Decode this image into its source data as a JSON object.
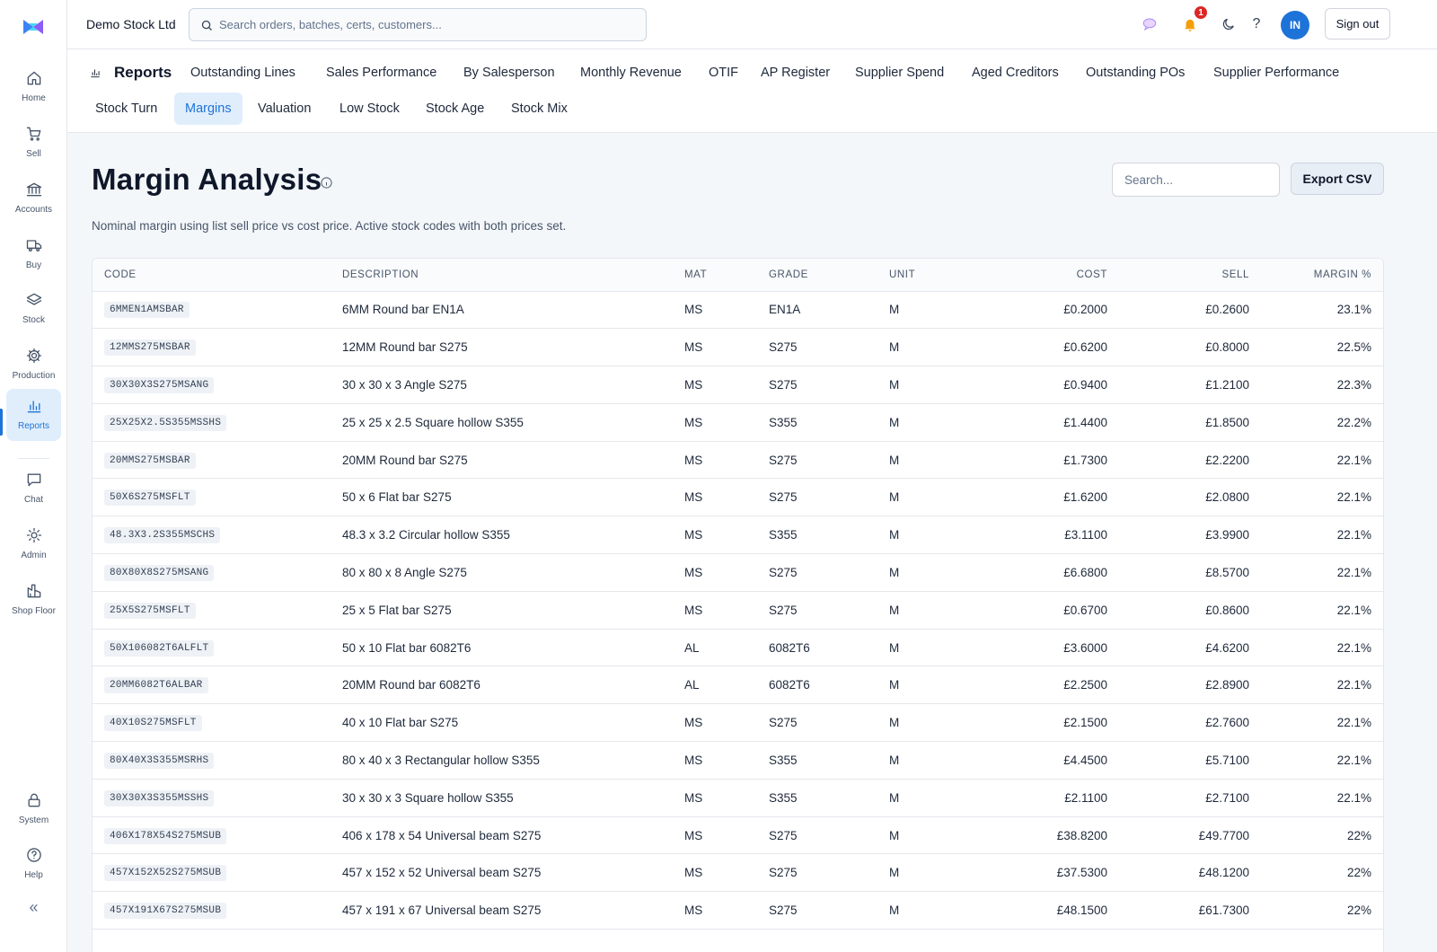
{
  "app": {
    "company": "Demo Stock Ltd",
    "search_placeholder": "Search orders, batches, certs, customers...",
    "notification_count": "1",
    "avatar_initials": "IN",
    "signout_label": "Sign out",
    "accent_color": "#1e73d8"
  },
  "sidebar": {
    "items": [
      {
        "label": "Home",
        "icon": "home-icon"
      },
      {
        "label": "Sell",
        "icon": "cart-icon"
      },
      {
        "label": "Accounts",
        "icon": "bank-icon"
      },
      {
        "label": "Buy",
        "icon": "truck-icon"
      },
      {
        "label": "Stock",
        "icon": "layers-icon"
      },
      {
        "label": "Production",
        "icon": "gear-icon"
      },
      {
        "label": "Reports",
        "icon": "bar-chart-icon",
        "active": true
      },
      {
        "label": "Chat",
        "icon": "chat-icon"
      },
      {
        "label": "Admin",
        "icon": "sun-icon"
      },
      {
        "label": "Shop Floor",
        "icon": "factory-icon"
      },
      {
        "label": "System",
        "icon": "lock-icon"
      },
      {
        "label": "Help",
        "icon": "help-circle-icon"
      }
    ],
    "collapse_label": "«"
  },
  "reports_nav": {
    "heading": "Reports",
    "tabs": [
      "Outstanding Lines",
      "Sales Performance",
      "By Salesperson",
      "Monthly Revenue",
      "OTIF",
      "AP Register",
      "Supplier Spend",
      "Aged Creditors",
      "Outstanding POs",
      "Supplier Performance",
      "Stock Turn",
      "Margins",
      "Valuation",
      "Low Stock",
      "Stock Age",
      "Stock Mix"
    ],
    "active_tab": "Margins"
  },
  "page": {
    "title": "Margin Analysis",
    "subtitle": "Nominal margin using list sell price vs cost price. Active stock codes with both prices set.",
    "search_placeholder": "Search...",
    "export_label": "Export CSV"
  },
  "table": {
    "columns": [
      "CODE",
      "DESCRIPTION",
      "MAT",
      "GRADE",
      "UNIT",
      "COST",
      "SELL",
      "MARGIN %"
    ],
    "rows": [
      {
        "code": "6MMEN1AMSBAR",
        "desc": "6MM Round bar EN1A",
        "mat": "MS",
        "grade": "EN1A",
        "unit": "M",
        "cost": "£0.2000",
        "sell": "£0.2600",
        "margin": "23.1%"
      },
      {
        "code": "12MMS275MSBAR",
        "desc": "12MM Round bar S275",
        "mat": "MS",
        "grade": "S275",
        "unit": "M",
        "cost": "£0.6200",
        "sell": "£0.8000",
        "margin": "22.5%"
      },
      {
        "code": "30X30X3S275MSANG",
        "desc": "30 x 30 x 3 Angle S275",
        "mat": "MS",
        "grade": "S275",
        "unit": "M",
        "cost": "£0.9400",
        "sell": "£1.2100",
        "margin": "22.3%"
      },
      {
        "code": "25X25X2.5S355MSSHS",
        "desc": "25 x 25 x 2.5 Square hollow S355",
        "mat": "MS",
        "grade": "S355",
        "unit": "M",
        "cost": "£1.4400",
        "sell": "£1.8500",
        "margin": "22.2%"
      },
      {
        "code": "20MMS275MSBAR",
        "desc": "20MM Round bar S275",
        "mat": "MS",
        "grade": "S275",
        "unit": "M",
        "cost": "£1.7300",
        "sell": "£2.2200",
        "margin": "22.1%"
      },
      {
        "code": "50X6S275MSFLT",
        "desc": "50 x 6 Flat bar S275",
        "mat": "MS",
        "grade": "S275",
        "unit": "M",
        "cost": "£1.6200",
        "sell": "£2.0800",
        "margin": "22.1%"
      },
      {
        "code": "48.3X3.2S355MSCHS",
        "desc": "48.3 x 3.2 Circular hollow S355",
        "mat": "MS",
        "grade": "S355",
        "unit": "M",
        "cost": "£3.1100",
        "sell": "£3.9900",
        "margin": "22.1%"
      },
      {
        "code": "80X80X8S275MSANG",
        "desc": "80 x 80 x 8 Angle S275",
        "mat": "MS",
        "grade": "S275",
        "unit": "M",
        "cost": "£6.6800",
        "sell": "£8.5700",
        "margin": "22.1%"
      },
      {
        "code": "25X5S275MSFLT",
        "desc": "25 x 5 Flat bar S275",
        "mat": "MS",
        "grade": "S275",
        "unit": "M",
        "cost": "£0.6700",
        "sell": "£0.8600",
        "margin": "22.1%"
      },
      {
        "code": "50X106082T6ALFLT",
        "desc": "50 x 10 Flat bar 6082T6",
        "mat": "AL",
        "grade": "6082T6",
        "unit": "M",
        "cost": "£3.6000",
        "sell": "£4.6200",
        "margin": "22.1%"
      },
      {
        "code": "20MM6082T6ALBAR",
        "desc": "20MM Round bar 6082T6",
        "mat": "AL",
        "grade": "6082T6",
        "unit": "M",
        "cost": "£2.2500",
        "sell": "£2.8900",
        "margin": "22.1%"
      },
      {
        "code": "40X10S275MSFLT",
        "desc": "40 x 10 Flat bar S275",
        "mat": "MS",
        "grade": "S275",
        "unit": "M",
        "cost": "£2.1500",
        "sell": "£2.7600",
        "margin": "22.1%"
      },
      {
        "code": "80X40X3S355MSRHS",
        "desc": "80 x 40 x 3 Rectangular hollow S355",
        "mat": "MS",
        "grade": "S355",
        "unit": "M",
        "cost": "£4.4500",
        "sell": "£5.7100",
        "margin": "22.1%"
      },
      {
        "code": "30X30X3S355MSSHS",
        "desc": "30 x 30 x 3 Square hollow S355",
        "mat": "MS",
        "grade": "S355",
        "unit": "M",
        "cost": "£2.1100",
        "sell": "£2.7100",
        "margin": "22.1%"
      },
      {
        "code": "406X178X54S275MSUB",
        "desc": "406 x 178 x 54 Universal beam S275",
        "mat": "MS",
        "grade": "S275",
        "unit": "M",
        "cost": "£38.8200",
        "sell": "£49.7700",
        "margin": "22%"
      },
      {
        "code": "457X152X52S275MSUB",
        "desc": "457 x 152 x 52 Universal beam S275",
        "mat": "MS",
        "grade": "S275",
        "unit": "M",
        "cost": "£37.5300",
        "sell": "£48.1200",
        "margin": "22%"
      },
      {
        "code": "457X191X67S275MSUB",
        "desc": "457 x 191 x 67 Universal beam S275",
        "mat": "MS",
        "grade": "S275",
        "unit": "M",
        "cost": "£48.1500",
        "sell": "£61.7300",
        "margin": "22%"
      }
    ]
  }
}
